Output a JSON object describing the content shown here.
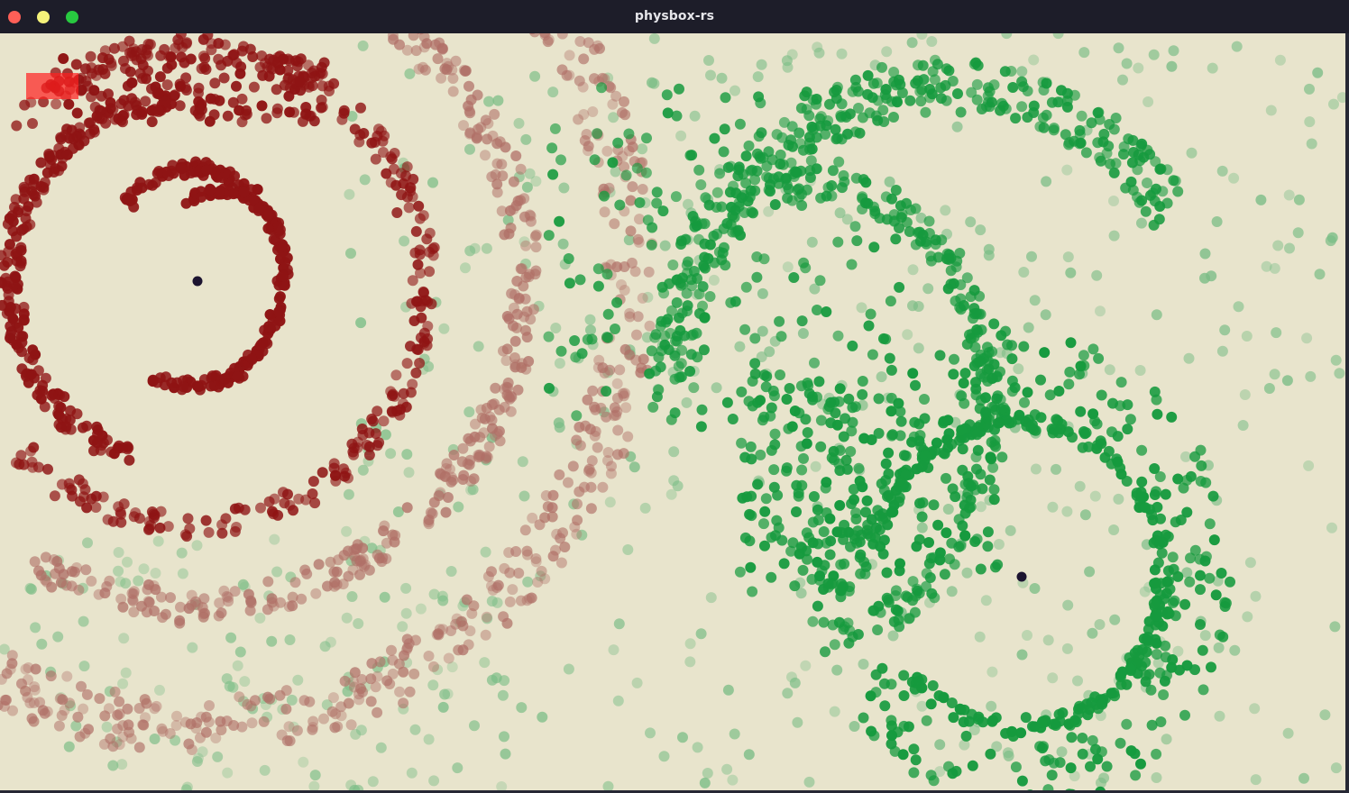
{
  "window": {
    "title": "physbox-rs",
    "controls": [
      {
        "name": "close",
        "color": "#ff5f57"
      },
      {
        "name": "minimize",
        "color": "#f5f27a"
      },
      {
        "name": "maximize",
        "color": "#28c940"
      }
    ]
  },
  "simulation": {
    "background": "#e8e4cc",
    "particle_colors": {
      "red_dark": "#8f1414",
      "red_faint": "#b07067",
      "green": "#169a3e",
      "green_faint": "#7bbd86",
      "attractor": "#1c1430",
      "spawn_box": "#ff2020"
    }
  }
}
